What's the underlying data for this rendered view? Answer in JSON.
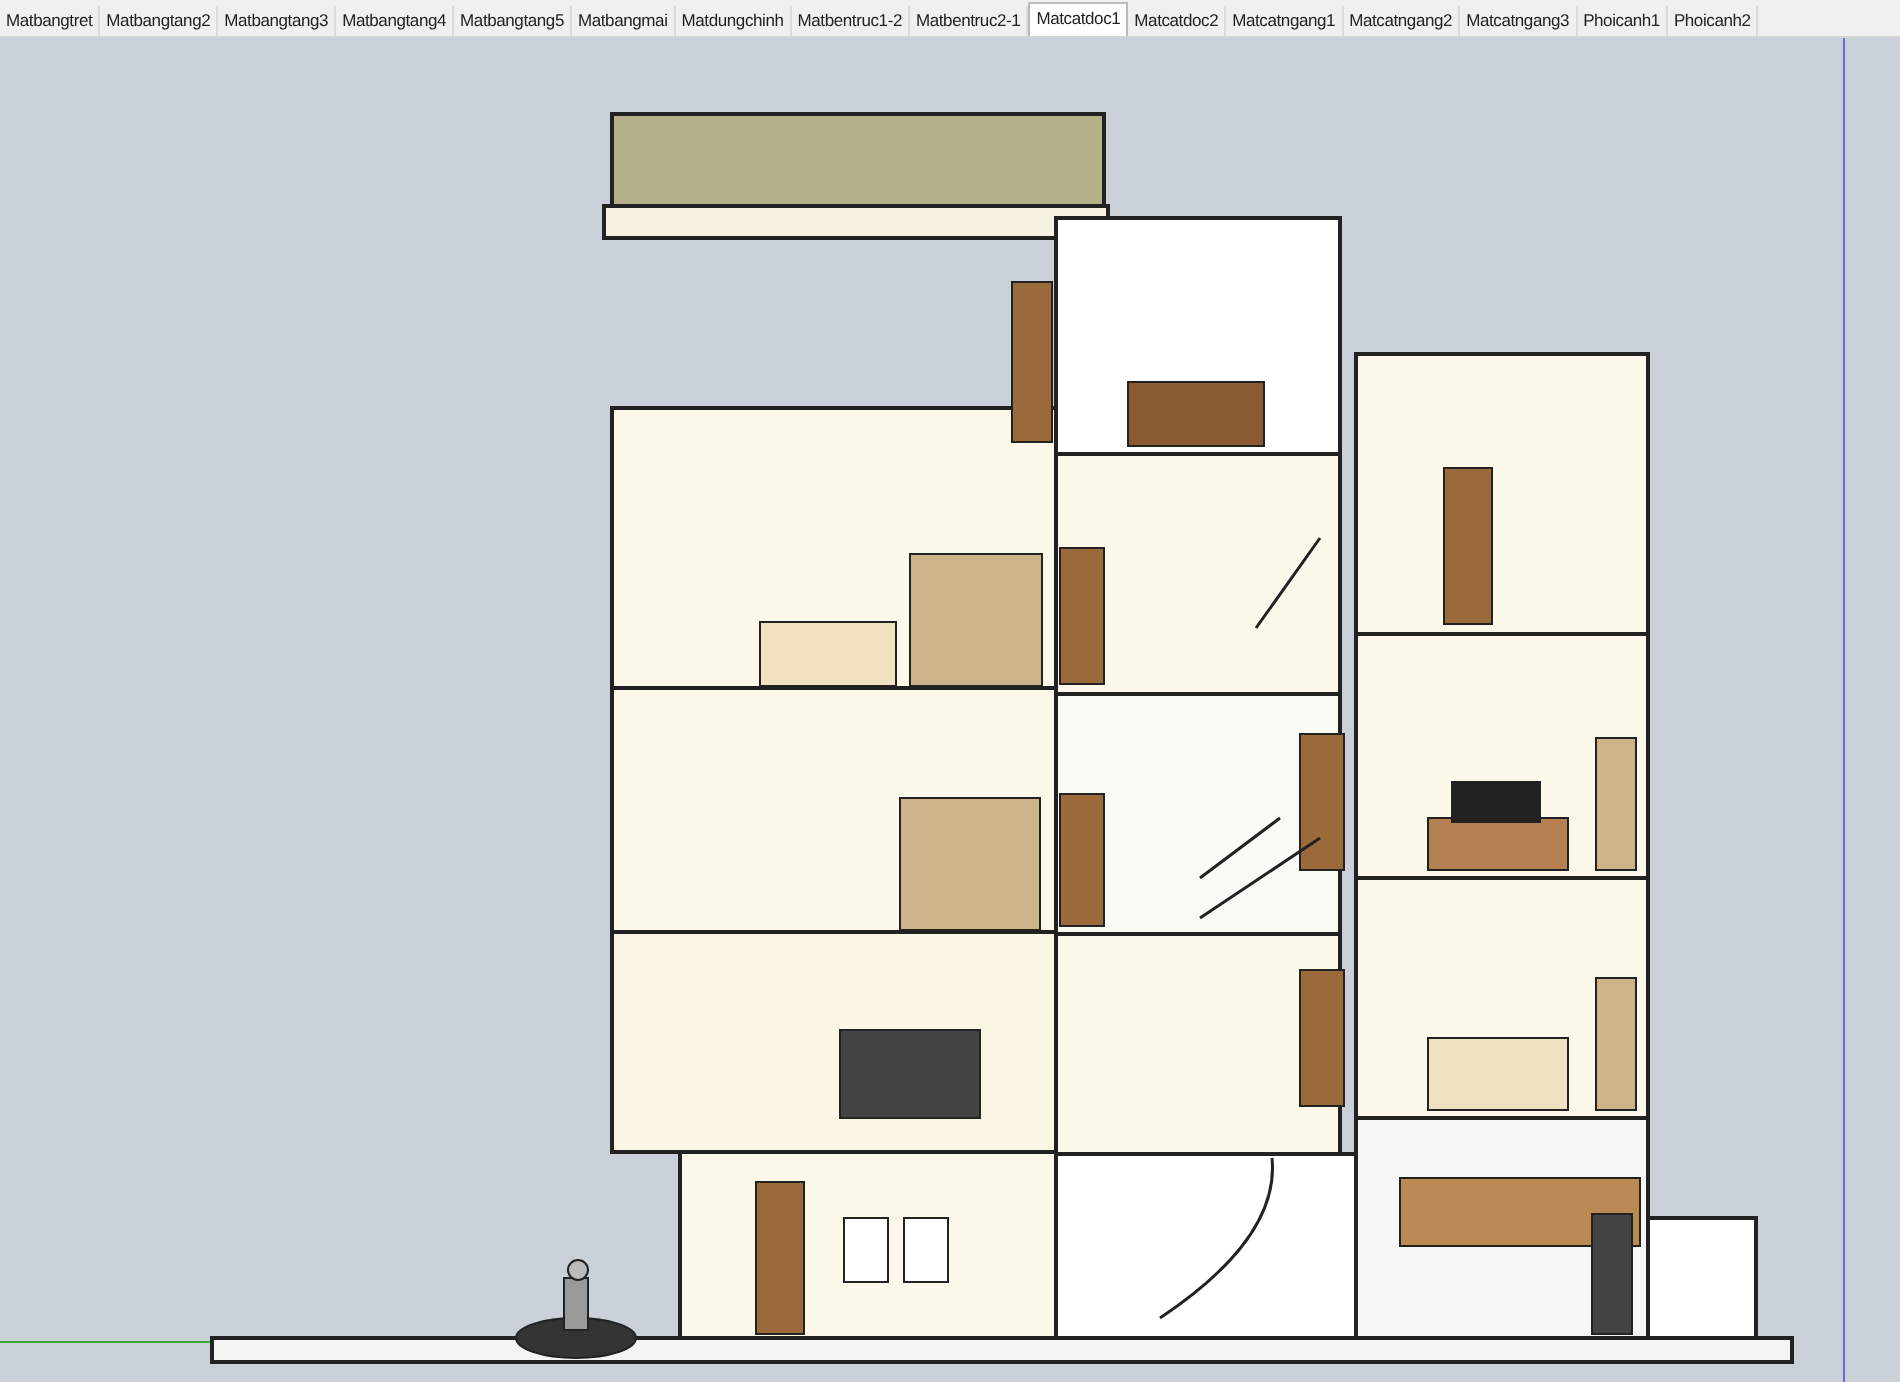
{
  "tabs": [
    {
      "label": "Matbangtret",
      "selected": false
    },
    {
      "label": "Matbangtang2",
      "selected": false
    },
    {
      "label": "Matbangtang3",
      "selected": false
    },
    {
      "label": "Matbangtang4",
      "selected": false
    },
    {
      "label": "Matbangtang5",
      "selected": false
    },
    {
      "label": "Matbangmai",
      "selected": false
    },
    {
      "label": "Matdungchinh",
      "selected": false
    },
    {
      "label": "Matbentruc1-2",
      "selected": false
    },
    {
      "label": "Matbentruc2-1",
      "selected": false
    },
    {
      "label": "Matcatdoc1",
      "selected": true
    },
    {
      "label": "Matcatdoc2",
      "selected": false
    },
    {
      "label": "Matcatngang1",
      "selected": false
    },
    {
      "label": "Matcatngang2",
      "selected": false
    },
    {
      "label": "Matcatngang3",
      "selected": false
    },
    {
      "label": "Phoicanh1",
      "selected": false
    },
    {
      "label": "Phoicanh2",
      "selected": false
    }
  ]
}
